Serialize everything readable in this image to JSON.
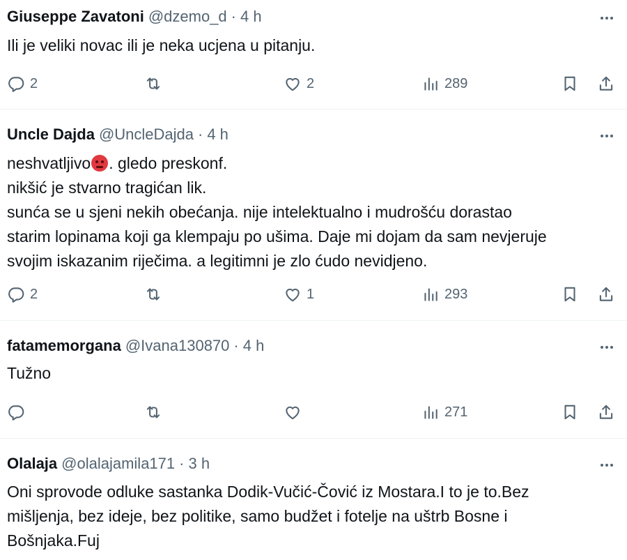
{
  "tweets": [
    {
      "name": "Giuseppe Zavatoni",
      "handle": "@dzemo_d",
      "separator": "·",
      "time": "4 h",
      "lines": [
        "Ili je veliki novac ili je neka ucjena u pitanju."
      ],
      "replies": "2",
      "retweets": "",
      "likes": "2",
      "views": "289"
    },
    {
      "name": "Uncle Dajda",
      "handle": "@UncleDajda",
      "separator": "·",
      "time": "4 h",
      "line1_before_emoji": "neshvatljivo",
      "line1_after_emoji": ". gledo preskonf.",
      "lines": [
        "nikšić je stvarno tragićan lik.",
        "sunća se u sjeni nekih obećanja. nije intelektualno i mudrošću dorastao",
        "starim lopinama koji ga klempaju po ušima. Daje mi dojam da sam nevjeruje",
        "svojim iskazanim riječima. a legitimni je zlo ćudo nevidjeno."
      ],
      "emoji": "angry-face-emoji",
      "replies": "2",
      "retweets": "",
      "likes": "1",
      "views": "293"
    },
    {
      "name": "fatamemorgana",
      "handle": "@Ivana130870",
      "separator": "·",
      "time": "4 h",
      "lines": [
        "Tužno"
      ],
      "replies": "",
      "retweets": "",
      "likes": "",
      "views": "271"
    },
    {
      "name": "Olalaja",
      "handle": "@olalajamila171",
      "separator": "·",
      "time": "3 h",
      "lines": [
        "Oni sprovode odluke sastanka Dodik-Vučić-Čović iz Mostara.I to je to.Bez",
        "mišljenja, bez ideje, bez politike, samo budžet i fotelje na uštrb Bosne i",
        "Bošnjaka.Fuj"
      ]
    }
  ],
  "colors": {
    "text": "#0f1419",
    "secondary": "#536471",
    "divider": "#eff3f4"
  },
  "icons": [
    "more-icon",
    "reply-icon",
    "retweet-icon",
    "like-icon",
    "views-icon",
    "bookmark-icon",
    "share-icon"
  ]
}
